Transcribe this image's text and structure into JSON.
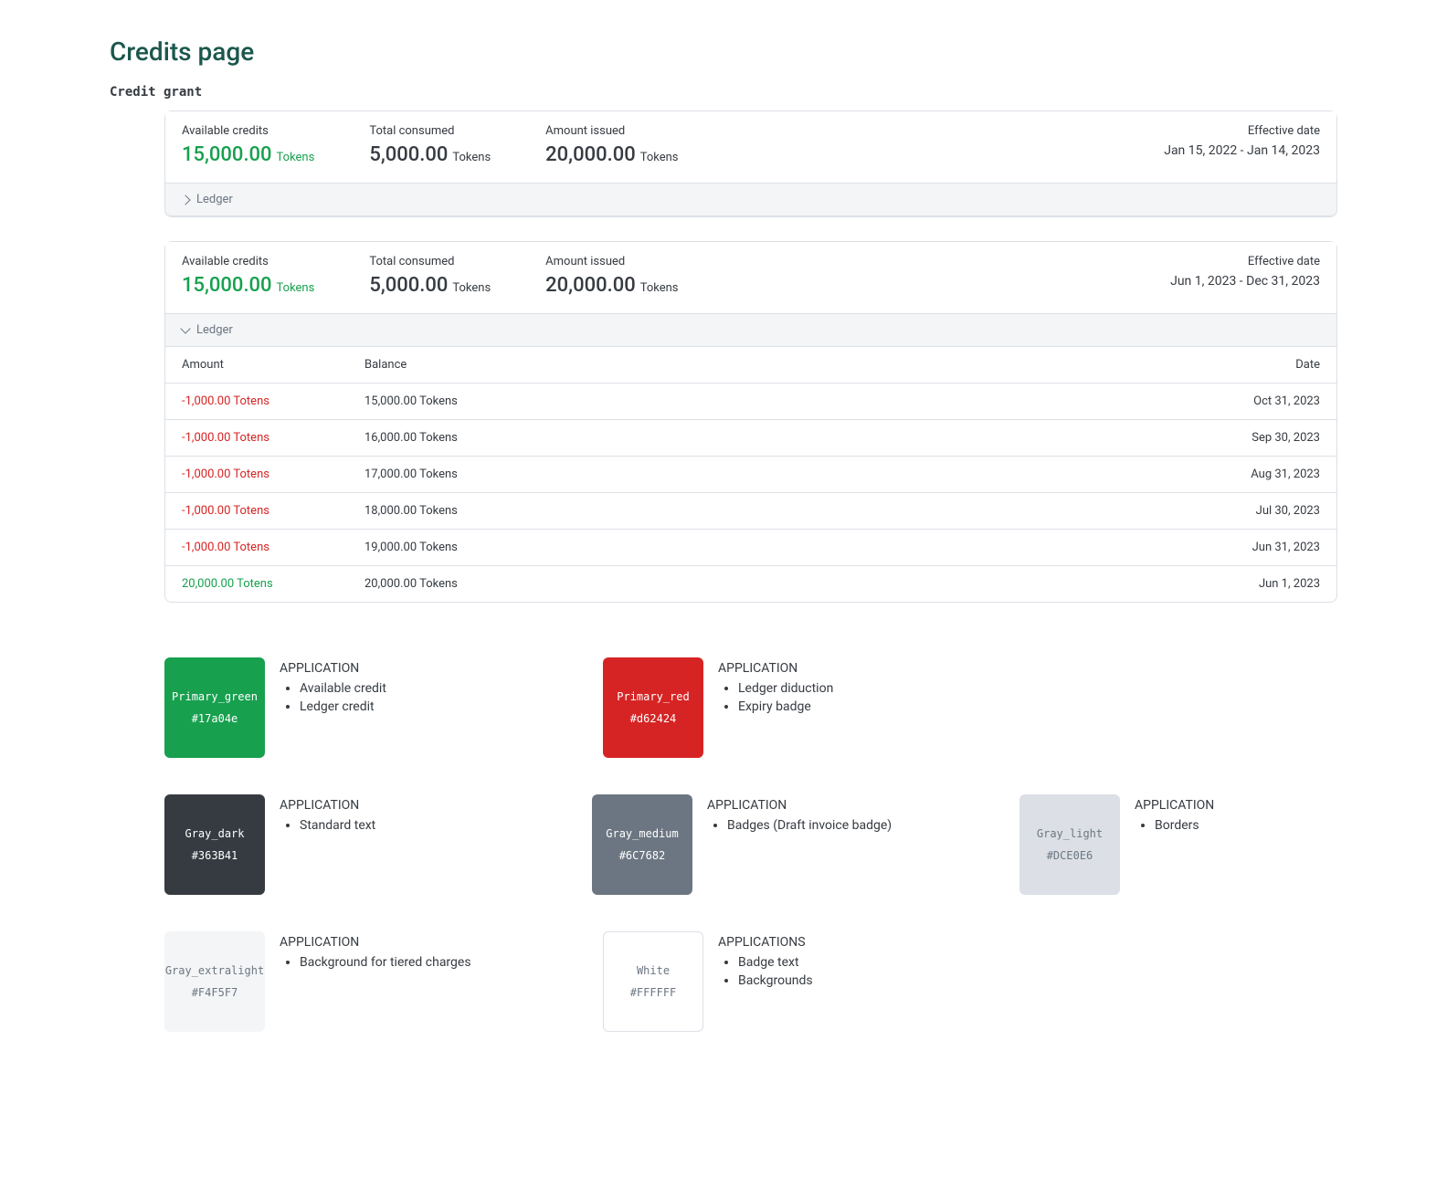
{
  "page_title": "Credits page",
  "section_label": "Credit grant",
  "ledger_label": "Ledger",
  "grants": [
    {
      "available_label": "Available credits",
      "available_value": "15,000.00",
      "available_unit": "Tokens",
      "consumed_label": "Total consumed",
      "consumed_value": "5,000.00",
      "consumed_unit": "Tokens",
      "issued_label": "Amount issued",
      "issued_value": "20,000.00",
      "issued_unit": "Tokens",
      "date_label": "Effective date",
      "date_value": "Jan 15, 2022 - Jan 14, 2023",
      "expanded": false
    },
    {
      "available_label": "Available credits",
      "available_value": "15,000.00",
      "available_unit": "Tokens",
      "consumed_label": "Total consumed",
      "consumed_value": "5,000.00",
      "consumed_unit": "Tokens",
      "issued_label": "Amount issued",
      "issued_value": "20,000.00",
      "issued_unit": "Tokens",
      "date_label": "Effective date",
      "date_value": "Jun 1, 2023 - Dec 31, 2023",
      "expanded": true
    }
  ],
  "ledger_columns": {
    "amount": "Amount",
    "balance": "Balance",
    "date": "Date"
  },
  "ledger_rows": [
    {
      "amount": "-1,000.00 Totens",
      "class": "neg",
      "balance": "15,000.00 Tokens",
      "date": "Oct 31, 2023"
    },
    {
      "amount": "-1,000.00 Totens",
      "class": "neg",
      "balance": "16,000.00 Tokens",
      "date": "Sep 30, 2023"
    },
    {
      "amount": "-1,000.00 Totens",
      "class": "neg",
      "balance": "17,000.00 Tokens",
      "date": "Aug 31, 2023"
    },
    {
      "amount": "-1,000.00 Totens",
      "class": "neg",
      "balance": "18,000.00 Tokens",
      "date": "Jul 30, 2023"
    },
    {
      "amount": "-1,000.00 Totens",
      "class": "neg",
      "balance": "19,000.00 Tokens",
      "date": "Jun 31, 2023"
    },
    {
      "amount": "20,000.00 Totens",
      "class": "pos",
      "balance": "20,000.00 Tokens",
      "date": "Jun 1, 2023"
    }
  ],
  "swatches": [
    [
      {
        "name": "Primary_green",
        "hex": "#17a04e",
        "text_class": "",
        "app_label": "APPLICATION",
        "apps": [
          "Available credit",
          "Ledger credit"
        ]
      },
      {
        "name": "Primary_red",
        "hex": "#d62424",
        "text_class": "",
        "app_label": "APPLICATION",
        "apps": [
          "Ledger diduction",
          "Expiry badge"
        ]
      }
    ],
    [
      {
        "name": "Gray_dark",
        "hex": "#363B41",
        "text_class": "",
        "app_label": "APPLICATION",
        "apps": [
          "Standard text"
        ]
      },
      {
        "name": "Gray_medium",
        "hex": "#6C7682",
        "text_class": "",
        "app_label": "APPLICATION",
        "apps": [
          "Badges (Draft invoice badge)"
        ]
      },
      {
        "name": "Gray_light",
        "hex": "#DCE0E6",
        "text_class": "light",
        "app_label": "APPLICATION",
        "apps": [
          "Borders"
        ]
      }
    ],
    [
      {
        "name": "Gray_extralight",
        "hex": "#F4F5F7",
        "text_class": "light",
        "app_label": "APPLICATION",
        "apps": [
          "Background for tiered charges"
        ]
      },
      {
        "name": "White",
        "hex": "#FFFFFF",
        "text_class": "light bordered",
        "app_label": "APPLICATIONS",
        "apps": [
          "Badge text",
          "Backgrounds"
        ]
      }
    ]
  ]
}
